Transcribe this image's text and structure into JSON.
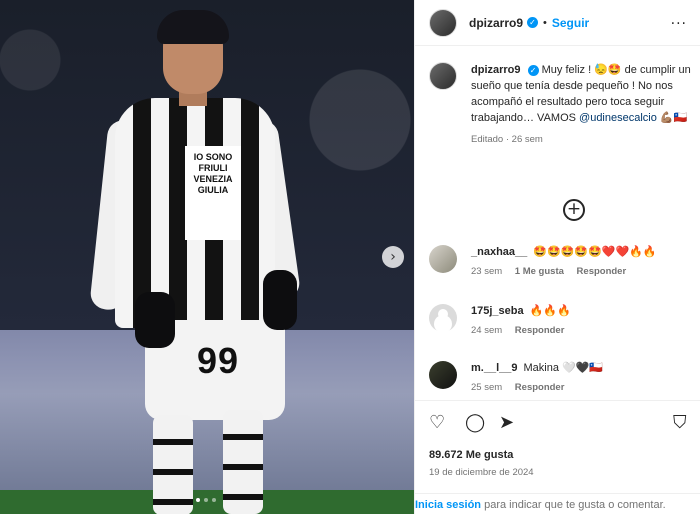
{
  "post": {
    "username": "dpizarro9",
    "follow_label": "Seguir",
    "separator": "•",
    "more_icon": "more-horizontal-icon",
    "caption_text": "Muy feliz ! 😓🤩 de cumplir un sueño que tenía desde pequeño ! No nos acompañó el resultado pero toca seguir trabajando… VAMOS",
    "caption_mention": "@udinesecalcio",
    "caption_end": "💪🏽🇨🇱",
    "caption_meta": "Editado · 26 sem"
  },
  "media": {
    "sponsor_lines": [
      "IO SONO",
      "FRIULI",
      "VENEZIA",
      "GIULIA"
    ],
    "shirt_number": "99",
    "next_icon": "chevron-right-icon",
    "slides": 3,
    "active_slide": 1
  },
  "comments": [
    {
      "user": "_naxhaa__",
      "text": "🤩🤩🤩🤩🤩❤️❤️🔥🔥",
      "time": "23 sem",
      "likes": "1 Me gusta",
      "reply": "Responder"
    },
    {
      "user": "175j_seba",
      "text": "🔥🔥🔥",
      "time": "24 sem",
      "likes": "",
      "reply": "Responder"
    },
    {
      "user": "m.__l__9",
      "text": "Makina 🤍🖤🇨🇱",
      "time": "25 sem",
      "likes": "",
      "reply": "Responder"
    }
  ],
  "actions": {
    "likes": "89.672 Me gusta",
    "date": "19 de diciembre de 2024",
    "login_link": "Inicia sesión",
    "login_rest": " para indicar que te gusta o comentar."
  },
  "colors": {
    "accent": "#0095f6",
    "text": "#262626",
    "muted": "#737373",
    "verified": "#0095f6"
  }
}
